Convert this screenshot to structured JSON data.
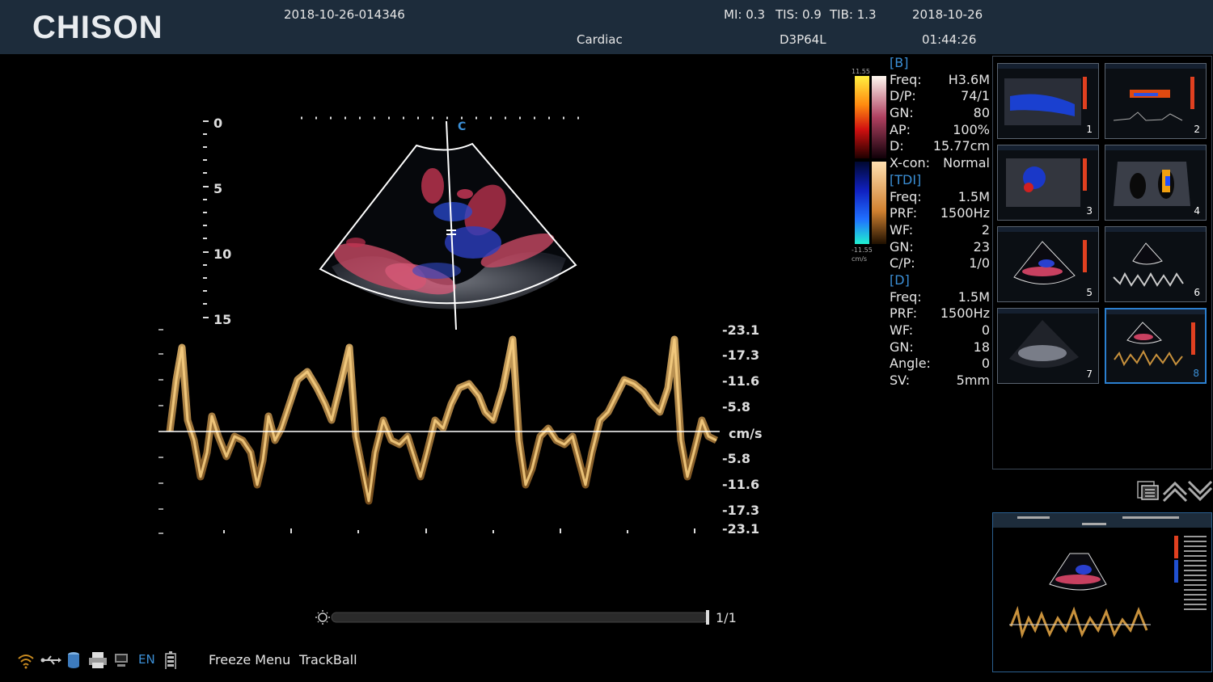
{
  "header": {
    "logo": "CHISON",
    "exam_id": "2018-10-26-014346",
    "preset": "Cardiac",
    "mi_label": "MI:",
    "mi_value": "0.3",
    "tis_label": "TIS:",
    "tis_value": "0.9",
    "tib_label": "TIB:",
    "tib_value": "1.3",
    "probe": "D3P64L",
    "date": "2018-10-26",
    "time": "01:44:26"
  },
  "image": {
    "cursor_label": "C",
    "depth_labels": [
      "0",
      "5",
      "10",
      "15"
    ]
  },
  "color_bar": {
    "top": "11.55",
    "bottom": "-11.55",
    "unit": "cm/s"
  },
  "params": {
    "b_header": "[B]",
    "b": [
      [
        "Freq:",
        "H3.6M"
      ],
      [
        "D/P:",
        "74/1"
      ],
      [
        "GN:",
        "80"
      ],
      [
        "AP:",
        "100%"
      ],
      [
        "D:",
        "15.77cm"
      ],
      [
        "X-con:",
        "Normal"
      ]
    ],
    "tdi_header": "[TDI]",
    "tdi": [
      [
        "Freq:",
        "1.5M"
      ],
      [
        "PRF:",
        "1500Hz"
      ],
      [
        "WF:",
        "2"
      ],
      [
        "GN:",
        "23"
      ],
      [
        "C/P:",
        "1/0"
      ]
    ],
    "d_header": "[D]",
    "d": [
      [
        "Freq:",
        "1.5M"
      ],
      [
        "PRF:",
        "1500Hz"
      ],
      [
        "WF:",
        "0"
      ],
      [
        "GN:",
        "18"
      ],
      [
        "Angle:",
        "0"
      ],
      [
        "SV:",
        "5mm"
      ]
    ]
  },
  "doppler": {
    "scale_labels": [
      "-23.1",
      "-17.3",
      "-11.6",
      "-5.8",
      "cm/s",
      "-5.8",
      "-11.6",
      "-17.3",
      "-23.1"
    ]
  },
  "thumbnails": [
    "1",
    "2",
    "3",
    "4",
    "5",
    "6",
    "7",
    "8"
  ],
  "cine": {
    "counter": "1/1"
  },
  "bottom": {
    "lang": "EN",
    "freeze_menu": "Freeze Menu",
    "trackball": "TrackBall"
  },
  "icons": [
    "wifi-icon",
    "usb-icon",
    "storage-icon",
    "printer-icon",
    "monitor-icon",
    "battery-icon",
    "list-icon",
    "page-up-icon",
    "page-down-icon",
    "brightness-icon"
  ],
  "colors": {
    "header_bg": "#1d2c3b",
    "accent_blue": "#3b8fd6",
    "doppler_trace": "#c8913c"
  }
}
